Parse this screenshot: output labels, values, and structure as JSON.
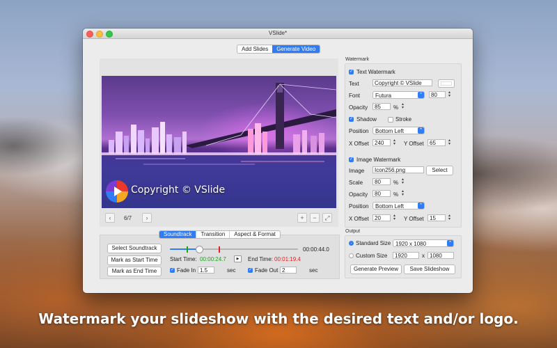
{
  "window": {
    "title": "VSlide*"
  },
  "mode_tabs": [
    "Add Slides",
    "Generate Video"
  ],
  "preview": {
    "watermark_text": "Copyright © VSlide",
    "counter": "6/7",
    "prev_icon": "chevron-left-icon",
    "next_icon": "chevron-right-icon",
    "zoom_in_icon": "plus-icon",
    "zoom_out_icon": "minus-icon",
    "fullscreen_icon": "expand-icon"
  },
  "bottom_tabs": [
    "Soundtrack",
    "Transition",
    "Aspect & Format"
  ],
  "soundtrack": {
    "select_button": "Select Soundtrack",
    "mark_start_button": "Mark as Start Time",
    "mark_end_button": "Mark as End Time",
    "duration": "00:00:44.0",
    "start_label": "Start Time:",
    "start_value": "00:00:24.7",
    "end_label": "End Time:",
    "end_value": "00:01:19.4",
    "fade_in_label": "Fade In",
    "fade_in_value": "1.5",
    "fade_in_unit": "sec",
    "fade_out_label": "Fade Out",
    "fade_out_value": "2",
    "fade_out_unit": "sec",
    "position_fraction": 0.27
  },
  "watermark": {
    "section_title": "Watermark",
    "text_watermark_label": "Text Watermark",
    "text_label": "Text",
    "text_value": "Copyright © VSlide",
    "font_label": "Font",
    "font_value": "Futura",
    "font_size": "80",
    "opacity_label": "Opacity",
    "opacity_value": "85",
    "opacity_unit": "%",
    "shadow_label": "Shadow",
    "stroke_label": "Stroke",
    "position_label": "Position",
    "position_value": "Bottom Left",
    "x_offset_label": "X Offset",
    "x_offset_value": "240",
    "y_offset_label": "Y Offset",
    "y_offset_value": "65",
    "image_watermark_label": "Image Watermark",
    "image_label": "Image",
    "image_value": "Icon256.png",
    "select_button": "Select",
    "scale_label": "Scale",
    "scale_value": "80",
    "scale_unit": "%",
    "img_opacity_label": "Opacity",
    "img_opacity_value": "80",
    "img_opacity_unit": "%",
    "img_position_label": "Position",
    "img_position_value": "Bottom Left",
    "img_x_offset_label": "X Offset",
    "img_x_offset_value": "20",
    "img_y_offset_label": "Y Offset",
    "img_y_offset_value": "15"
  },
  "output": {
    "section_title": "Output",
    "standard_size_label": "Standard Size",
    "standard_size_value": "1920 x 1080",
    "custom_size_label": "Custom Size",
    "custom_width": "1920",
    "size_separator": "x",
    "custom_height": "1080",
    "generate_preview_button": "Generate Preview",
    "save_slideshow_button": "Save Slideshow"
  },
  "caption": "Watermark your slideshow with the desired text and/or logo.",
  "colors": {
    "accent": "#2f7cf6",
    "start_time": "#1aa31a",
    "end_time": "#e02020"
  }
}
